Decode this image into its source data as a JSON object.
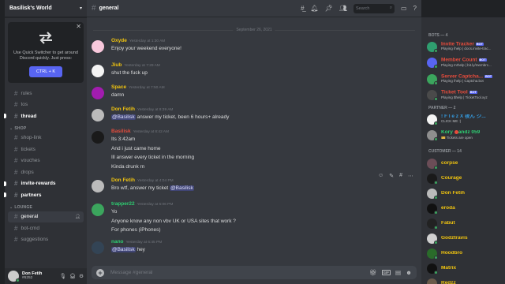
{
  "server": {
    "name": "Basilisk's World"
  },
  "quick_switcher": {
    "text": "Use Quick Switcher to get around Discord quickly. Just press:",
    "shortcut": "CTRL + K"
  },
  "channels_top": [
    {
      "name": "rules",
      "state": "normal"
    },
    {
      "name": "tos",
      "state": "normal"
    },
    {
      "name": "thread",
      "state": "unread"
    }
  ],
  "categories": {
    "shop": "SHOP",
    "lounge": "LOUNGE"
  },
  "shop_channels": [
    {
      "name": "shop-link",
      "state": "normal"
    },
    {
      "name": "tickets",
      "state": "normal"
    },
    {
      "name": "vouches",
      "state": "normal"
    },
    {
      "name": "drops",
      "state": "normal"
    },
    {
      "name": "invite-rewards",
      "state": "unread"
    },
    {
      "name": "partners",
      "state": "unread"
    }
  ],
  "lounge_channels": [
    {
      "name": "general",
      "state": "active"
    },
    {
      "name": "bot-cmd",
      "state": "normal"
    },
    {
      "name": "suggestions",
      "state": "normal"
    }
  ],
  "user": {
    "name": "Don Fetih",
    "tag": "#6252"
  },
  "header": {
    "channel": "general",
    "search_placeholder": "Search"
  },
  "date_divider": "September 26, 2021",
  "messages": [
    {
      "author": "Oxyde",
      "color": "#f1c40f",
      "avatar": "#f8c8dc",
      "time": "Yesterday at 1:30 AM",
      "lines": [
        "Enjoy your weekend everyone!"
      ]
    },
    {
      "author": "Jiub",
      "color": "#f1c40f",
      "avatar": "#f4f4f4",
      "time": "Yesterday at 7:29 AM",
      "lines": [
        "shut the fuck up"
      ]
    },
    {
      "author": "Space",
      "color": "#f1c40f",
      "avatar": "#a21caf",
      "time": "Yesterday at 7:50 AM",
      "lines": [
        "damn"
      ]
    },
    {
      "author": "Don Fetih",
      "color": "#f1c40f",
      "avatar": "#bbbbbb",
      "time": "Yesterday at 8:39 AM",
      "mention": "@Basilisk",
      "lines": [
        "answer my ticket, been 6 hours+ already"
      ]
    },
    {
      "author": "Basilisk",
      "color": "#e74c3c",
      "avatar": "#1a1a1a",
      "time": "Yesterday at 8:42 AM",
      "lines": [
        "Its 3:42am",
        "And i just came home",
        "Ill answer every ticket in the morning",
        "Kinda drunk rn"
      ]
    },
    {
      "author": "Don Fetih",
      "color": "#f1c40f",
      "avatar": "#bbbbbb",
      "time": "Yesterday at 4:04 PM",
      "lines": [
        "Bro wtf, answer my ticket"
      ],
      "trailing_mention": "@Basilisk"
    },
    {
      "author": "trapper22",
      "color": "#2ecc71",
      "avatar": "#3ba55d",
      "time": "Yesterday at 6:06 PM",
      "lines": [
        "Yo",
        "Anyone know any non vbv UK or USA sites that work ?",
        "For phones (iPhones)"
      ]
    },
    {
      "author": "nano",
      "color": "#2ecc71",
      "avatar": "#334455",
      "time": "Yesterday at 6:45 PM",
      "mention": "@Basilisk",
      "lines": [
        "hey"
      ]
    }
  ],
  "composer": {
    "placeholder": "Message #general"
  },
  "members": {
    "bots_header": "BOTS — 4",
    "bots": [
      {
        "name": "Invite Tracker",
        "activity": "Playing /help | docs.invite-trac...",
        "color": "#e74c3c",
        "avatar": "#2f9e6f"
      },
      {
        "name": "Member Count",
        "activity": "Playing m!help | bit.ly/membrc...",
        "color": "#e74c3c",
        "avatar": "#5865f2"
      },
      {
        "name": "Server Captcha...",
        "activity": "Playing /help | Captcha.bot",
        "color": "#e74c3c",
        "avatar": "#3ba55d"
      },
      {
        "name": "Ticket Tool",
        "activity": "Playing $help | TicketTool.xyz",
        "color": "#e74c3c",
        "avatar": "#4a4a4a"
      }
    ],
    "bot_badge": "BOT",
    "partner_header": "PARTNER — 2",
    "partners": [
      {
        "name": "! F l e z X 夜ん ジ...",
        "activity": "CLICK ME :)",
        "color": "#3498db",
        "avatar": "#f4f4f4"
      },
      {
        "name": "Kory",
        "name_suffix": "andz 059",
        "activity": "🎫 Tickets are open",
        "color": "#2ecc71",
        "avatar": "#8e8e8e"
      }
    ],
    "customer_header": "CUSTOMER — 14",
    "customers": [
      {
        "name": "corpse",
        "color": "#f1c40f",
        "avatar": "#6b4d57"
      },
      {
        "name": "Courage",
        "color": "#f1c40f",
        "avatar": "#1a1a1a"
      },
      {
        "name": "Don Fetih",
        "color": "#f1c40f",
        "avatar": "#bbbbbb"
      },
      {
        "name": "eroda",
        "color": "#f1c40f",
        "avatar": "#111111"
      },
      {
        "name": "Fabut",
        "color": "#f1c40f",
        "avatar": "#222222"
      },
      {
        "name": "Godztravis",
        "color": "#f1c40f",
        "avatar": "#d0d0d0"
      },
      {
        "name": "Hoodbro",
        "color": "#f1c40f",
        "avatar": "#2a6b2a"
      },
      {
        "name": "Matrix",
        "color": "#f1c40f",
        "avatar": "#111111"
      },
      {
        "name": "Redzz",
        "color": "#f1c40f",
        "avatar": "#6a5a4a"
      }
    ]
  }
}
